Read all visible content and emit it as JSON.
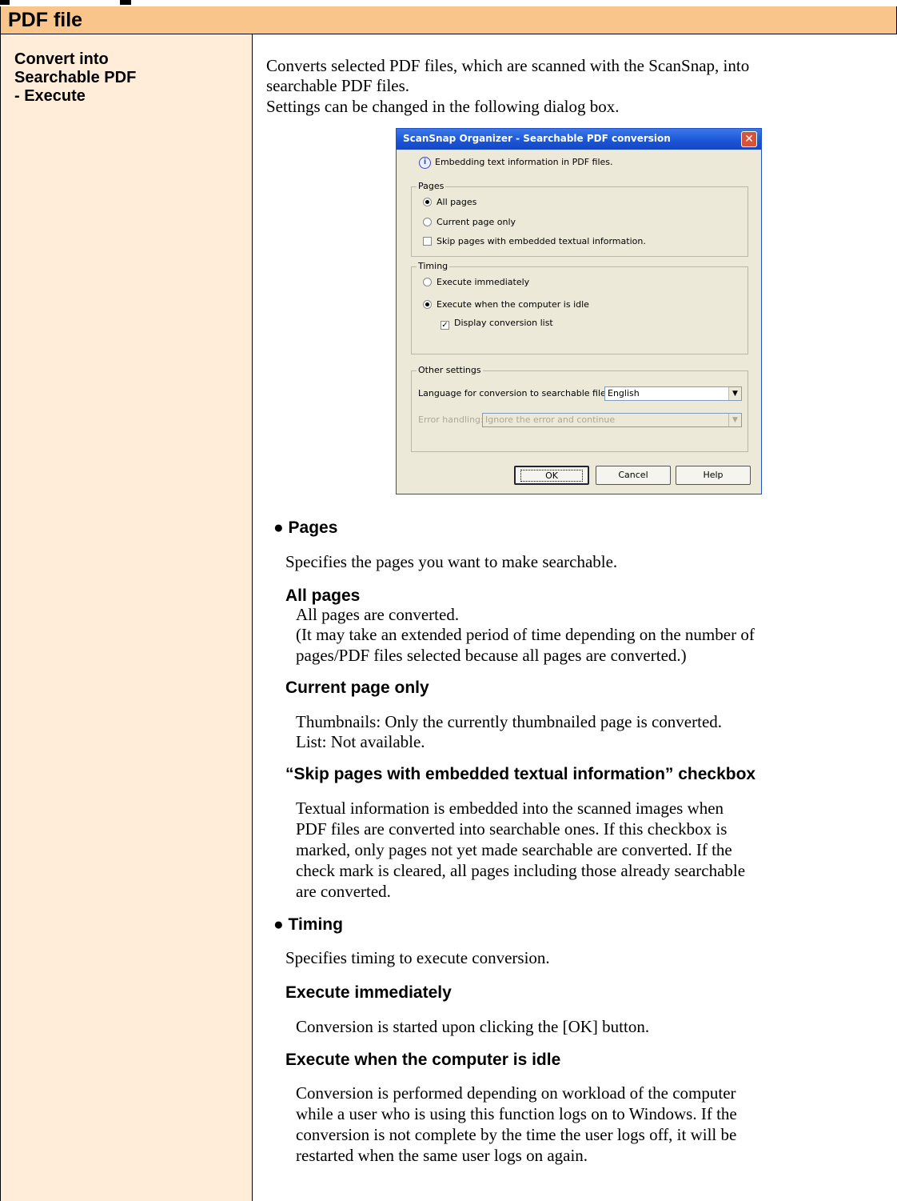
{
  "table": {
    "header_title": "PDF file",
    "left_label": "Convert into\nSearchable PDF\n- Execute"
  },
  "intro": {
    "line1": "Converts selected PDF files, which are scanned with the ScanSnap, into",
    "line2": "searchable PDF files.",
    "line3": "Settings can be changed in the following dialog box."
  },
  "dialog": {
    "title": "ScanSnap Organizer - Searchable PDF conversion",
    "info_text": "Embedding text information in PDF files.",
    "pages_group": "Pages",
    "all_pages": "All pages",
    "current_page_only": "Current page only",
    "skip_pages": "Skip pages with embedded textual information.",
    "timing_group": "Timing",
    "execute_immediately": "Execute immediately",
    "execute_idle": "Execute when the computer is idle",
    "display_list": "Display conversion list",
    "other_group": "Other settings",
    "language_label": "Language for conversion to searchable files:",
    "language_value": "English",
    "error_label": "Error handling:",
    "error_value": "Ignore the error and continue",
    "ok": "OK",
    "cancel": "Cancel",
    "help": "Help",
    "pages_selected": "All pages",
    "timing_selected": "Execute when the computer is idle",
    "skip_checked": false,
    "display_list_checked": true
  },
  "sections": {
    "pages_heading": "● Pages",
    "pages_desc": "Specifies the pages you want to make searchable.",
    "all_pages_heading": "All pages",
    "all_pages_l1": "All pages are converted.",
    "all_pages_l2": "(It may take an extended period of time depending on the number of",
    "all_pages_l3": "pages/PDF files selected because all pages are converted.)",
    "current_heading": "Current page only",
    "current_l1": "Thumbnails: Only the currently thumbnailed page is converted.",
    "current_l2": "List: Not available.",
    "skip_heading": "“Skip pages with embedded textual information” checkbox",
    "skip_l1": "Textual information is embedded into the scanned images when",
    "skip_l2": "PDF files are converted into searchable ones. If this checkbox is",
    "skip_l3": "marked, only pages not yet made searchable are converted. If the",
    "skip_l4": "check mark is cleared, all pages including those already searchable",
    "skip_l5": "are converted.",
    "timing_heading": "● Timing",
    "timing_desc": "Specifies timing to execute conversion.",
    "exec_imm_heading": "Execute immediately",
    "exec_imm_l1": "Conversion is started upon clicking the [OK] button.",
    "exec_idle_heading": "Execute when the computer is idle",
    "exec_idle_l1": "Conversion is performed depending on workload of the computer",
    "exec_idle_l2": "while a user who is using this function logs on to Windows. If the",
    "exec_idle_l3": "conversion is not complete by the time the user logs off, it will be",
    "exec_idle_l4": "restarted when the same user logs on again."
  }
}
